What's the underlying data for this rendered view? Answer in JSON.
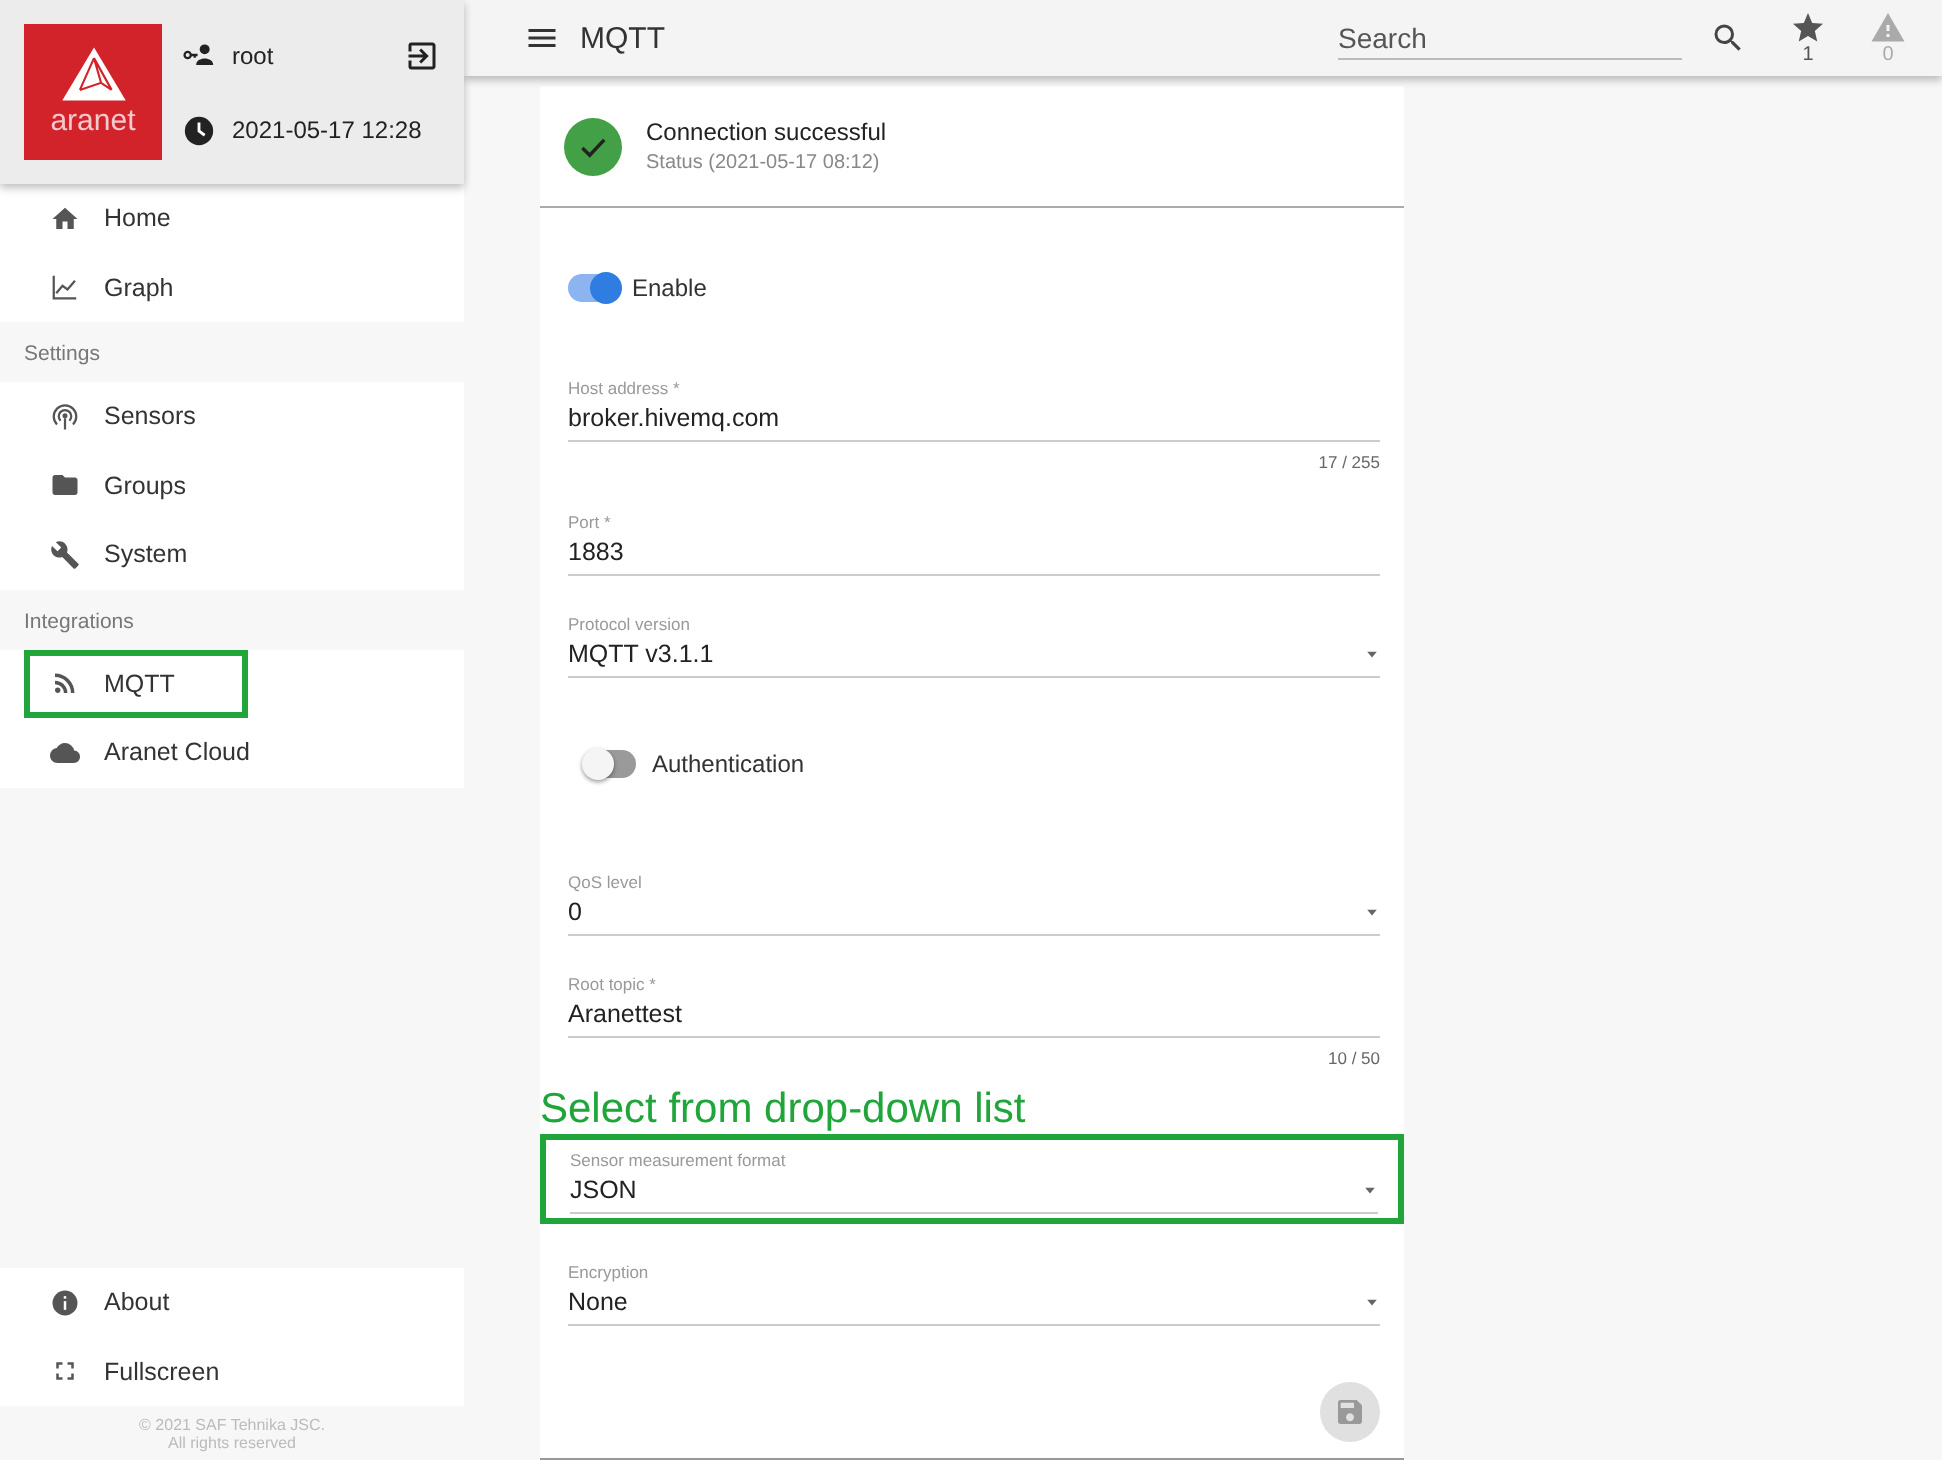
{
  "sidebar": {
    "logo_text": "aranet",
    "user": "root",
    "datetime": "2021-05-17 12:28",
    "nav_groups": [
      {
        "items": [
          {
            "label": "Home",
            "highlighted": false
          },
          {
            "label": "Graph",
            "highlighted": false
          }
        ]
      },
      {
        "heading": "Settings",
        "items": [
          {
            "label": "Sensors",
            "highlighted": false
          },
          {
            "label": "Groups",
            "highlighted": false
          },
          {
            "label": "System",
            "highlighted": false
          }
        ]
      },
      {
        "heading": "Integrations",
        "items": [
          {
            "label": "MQTT",
            "highlighted": true
          },
          {
            "label": "Aranet Cloud",
            "highlighted": false
          }
        ]
      }
    ],
    "bottom_items": [
      {
        "label": "About"
      },
      {
        "label": "Fullscreen"
      }
    ],
    "footer": [
      "© 2021 SAF Tehnika JSC.",
      "All rights reserved"
    ]
  },
  "top_bar": {
    "title": "MQTT",
    "search": {
      "placeholder": "Search"
    },
    "indicators": [
      {
        "count": "1",
        "dimmed": false
      },
      {
        "count": "0",
        "dimmed": true
      }
    ]
  },
  "status": {
    "kind": "success",
    "title": "Connection successful",
    "subtitle": "Status (2021-05-17 08:12)"
  },
  "form": {
    "fields": [
      {
        "kind": "toggle",
        "label": "Enable",
        "on": true
      },
      {
        "kind": "text",
        "label": "Host address *",
        "value": "broker.hivemq.com",
        "counter": "17 / 255"
      },
      {
        "kind": "text",
        "label": "Port *",
        "value": "1883"
      },
      {
        "kind": "select",
        "label": "Protocol version",
        "value": "MQTT v3.1.1"
      },
      {
        "kind": "toggle",
        "label": "Authentication",
        "on": false
      },
      {
        "kind": "select",
        "label": "QoS level",
        "value": "0"
      },
      {
        "kind": "text",
        "label": "Root topic *",
        "value": "Aranettest",
        "counter": "10 / 50"
      },
      {
        "kind": "select",
        "label": "Sensor measurement format",
        "value": "JSON",
        "annotation": "Select from drop-down list"
      },
      {
        "kind": "select",
        "label": "Encryption",
        "value": "None"
      }
    ],
    "save_button": {
      "disabled": true
    }
  }
}
